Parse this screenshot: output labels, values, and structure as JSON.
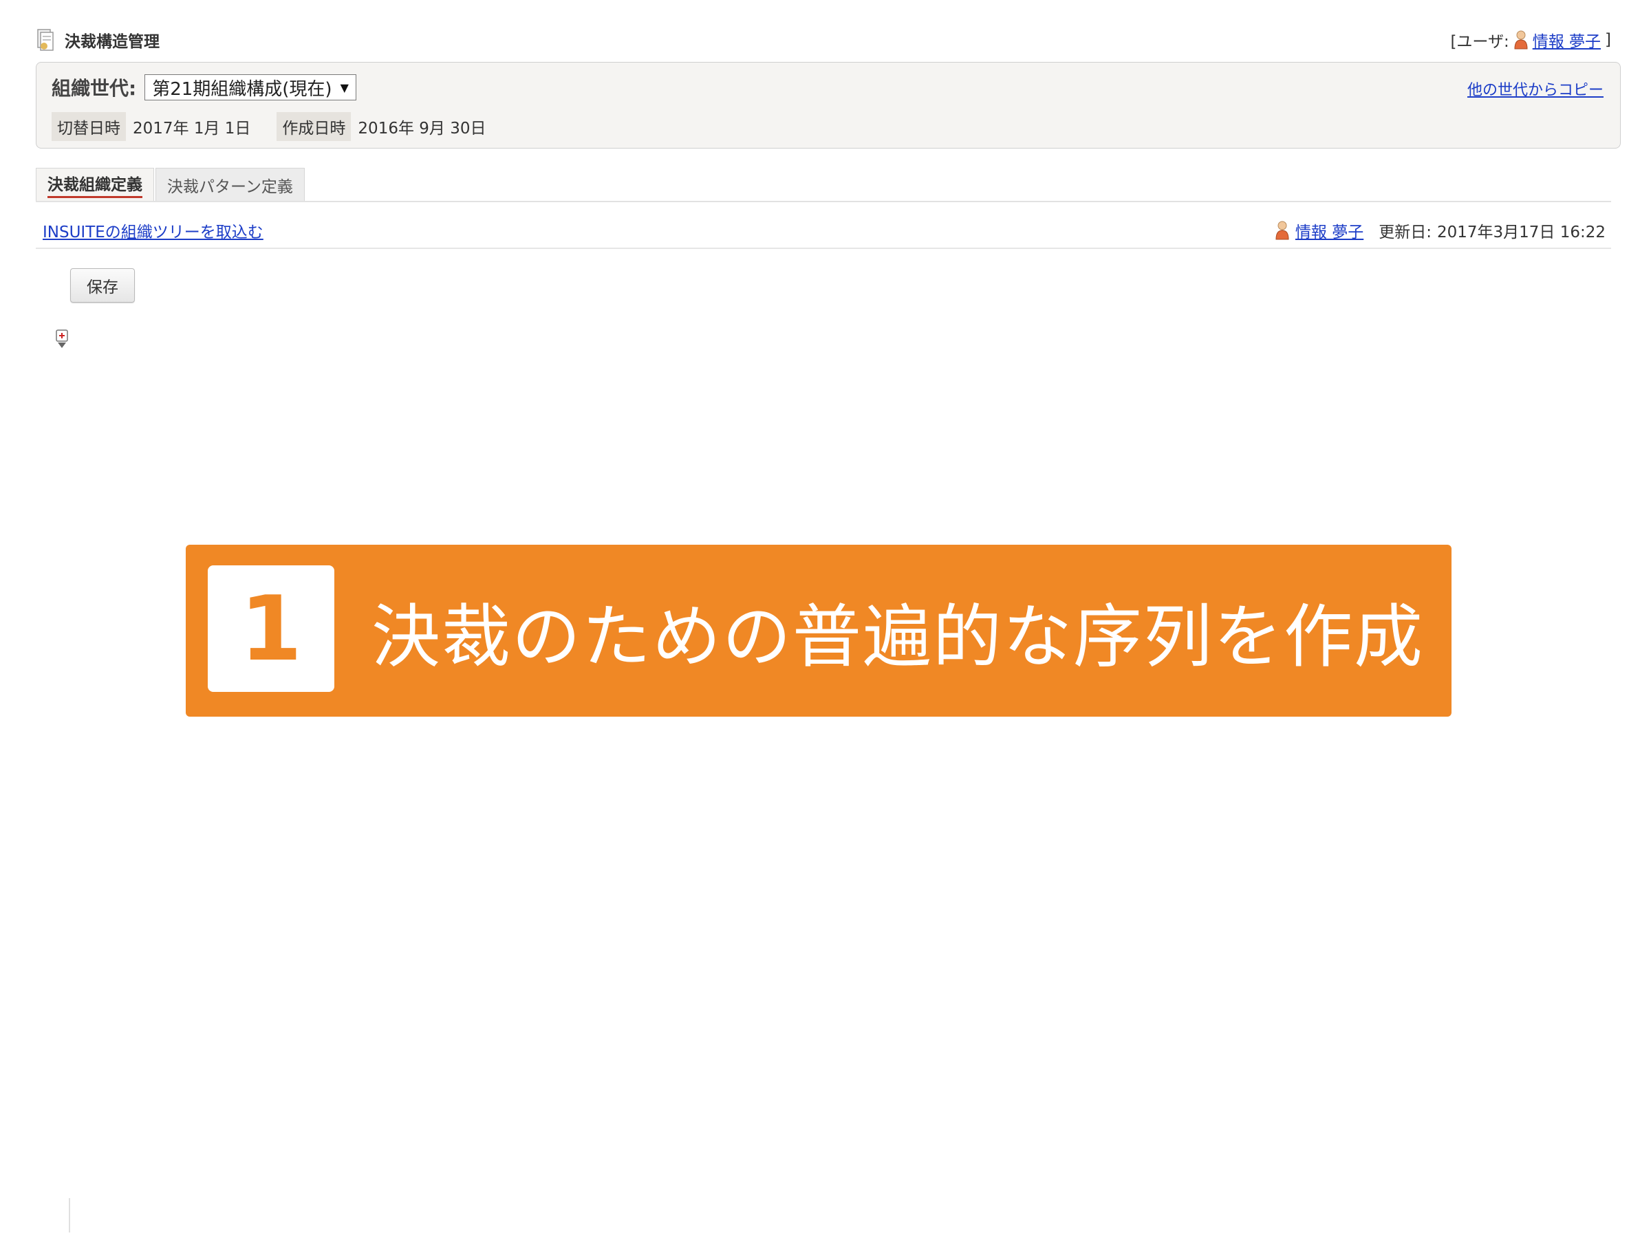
{
  "header": {
    "title": "決裁構造管理",
    "user_prefix": "[ユーザ:",
    "user_name": "情報 夢子",
    "user_suffix": "]"
  },
  "generation": {
    "label": "組織世代:",
    "selected": "第21期組織構成(現在)",
    "copy_link": "他の世代からコピー",
    "switch_date_label": "切替日時",
    "switch_date_value": "2017年 1月 1日",
    "created_date_label": "作成日時",
    "created_date_value": "2016年 9月 30日"
  },
  "tabs": [
    {
      "label": "決裁組織定義",
      "active": true
    },
    {
      "label": "決裁パターン定義",
      "active": false
    }
  ],
  "toolbar": {
    "import_link": "INSUITEの組織ツリーを取込む",
    "updater_name": "情報 夢子",
    "updated_label": "更新日:",
    "updated_value": "2017年3月17日  16:22",
    "save_label": "保存"
  },
  "banner": {
    "step": "1",
    "text": "決裁のための普遍的な序列を作成",
    "color": "#f08825"
  },
  "icons": {
    "app": "document-icon",
    "user": "person-icon",
    "tree": "tree-expand-icon"
  }
}
